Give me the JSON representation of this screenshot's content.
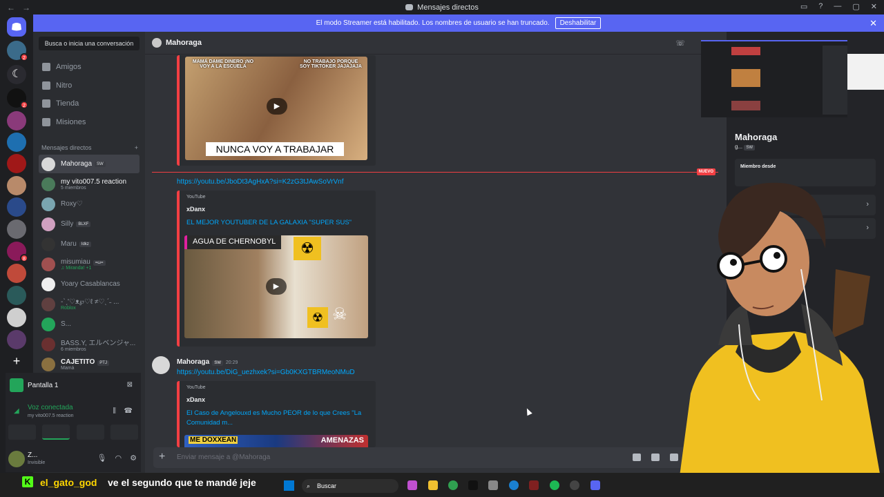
{
  "window": {
    "title": "Mensajes directos"
  },
  "banner": {
    "text": "El modo Streamer está habilitado. Los nombres de usuario se han truncado.",
    "button": "Deshabilitar",
    "close": "✕"
  },
  "sidebar": {
    "search": "Busca o inicia una conversación",
    "nav": [
      {
        "label": "Amigos",
        "icon": "friends-icon"
      },
      {
        "label": "Nitro",
        "icon": "nitro-icon"
      },
      {
        "label": "Tienda",
        "icon": "shop-icon"
      },
      {
        "label": "Misiones",
        "icon": "quests-icon"
      }
    ],
    "dm_header": "Mensajes directos",
    "dm_add": "+",
    "dms": [
      {
        "name": "Mahoraga",
        "tag": "SW",
        "sub": ""
      },
      {
        "name": "my vito007.5 reaction",
        "tag": "",
        "sub": "5 miembros"
      },
      {
        "name": "Roxy♡",
        "tag": "",
        "sub": ""
      },
      {
        "name": "Silly",
        "tag": "BLXF",
        "sub": ""
      },
      {
        "name": "Maru",
        "tag": "Idkz",
        "sub": ""
      },
      {
        "name": "misumiau",
        "tag": "=ω=",
        "sub": "♫ Miranda! +1"
      },
      {
        "name": "Yoary Casablancas",
        "tag": "",
        "sub": ""
      },
      {
        "name": "-ˋˏ'♡ᴥ℘♡ℓ ≠♡ˎˊ˗ ...",
        "tag": "",
        "sub": "Roblox"
      },
      {
        "name": "S...",
        "tag": "",
        "sub": ""
      },
      {
        "name": "BASS.Y, エルベンジャ...",
        "tag": "",
        "sub": "6 miembros"
      },
      {
        "name": "CAJETITO",
        "tag": "PTJ",
        "sub": "Mamá"
      }
    ]
  },
  "voice": {
    "screen": "Pantalla 1",
    "status": "Voz conectada",
    "channel": "my vito007.5 reaction"
  },
  "user": {
    "name": "Z...",
    "status": "Invisible"
  },
  "chat": {
    "header": "Mahoraga",
    "thumb1": {
      "top_left": "MAMÁ DAME DINERO ¡NO VOY A LA ESCUELA",
      "top_right": "NO TRABAJO PORQUE SOY TIKTOKER JAJAJAJA",
      "caption": "NUNCA VOY A TRABAJAR"
    },
    "new_tag": "NUEVO",
    "link1": "https://youtu.be/JboDt3AgHxA?si=K2zG3tJAwSoVrVnf",
    "embed1": {
      "provider": "YouTube",
      "author": "xDanx",
      "title": "EL MEJOR YOUTUBER DE LA GALAXIA \"SUPER SUS\"",
      "thumb_text": "AGUA DE CHERNOBYL"
    },
    "message": {
      "author": "Mahoraga",
      "tag": "SW",
      "time": "20:29"
    },
    "link2": "https://youtu.be/DiG_uezhxek?si=Gb0KXGTBRMeoNMuD",
    "embed2": {
      "provider": "YouTube",
      "author": "xDanx",
      "title": "El Caso de Angelouxd es Mucho PEOR de lo que Crees \"La Comunidad m...",
      "thumb_left": "ME DOXXEAN",
      "thumb_right": "AMENAZAS"
    },
    "composer_placeholder": "Enviar mensaje a @Mahoraga"
  },
  "profile": {
    "name": "Mahoraga",
    "info": "g...",
    "tag": "SW",
    "member_since": "Miembro desde"
  },
  "stream_chat": {
    "user": "el_gato_god",
    "message": "ve el segundo que te mandé jeje"
  },
  "taskbar": {
    "search": "Buscar"
  },
  "colors": {
    "accent": "#5865f2",
    "danger": "#f23f43",
    "link": "#00a8fc",
    "online": "#23a55a"
  }
}
